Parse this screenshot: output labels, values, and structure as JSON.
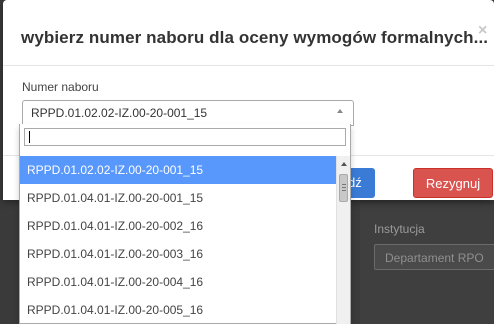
{
  "background": {
    "institution_label": "Instytucja",
    "institution_value": "Departament RPO"
  },
  "modal": {
    "title": "wybierz numer naboru dla oceny wymogów formalnych...",
    "close_symbol": "×",
    "field_label": "Numer naboru",
    "selected_value": "RPPD.01.02.02-IZ.00-20-001_15",
    "search": {
      "value": "",
      "placeholder": ""
    },
    "buttons": {
      "primary_partial_label": "dź",
      "cancel_label": "Rezygnuj"
    },
    "options": [
      "RPPD.01.02.02-IZ.00-20-001_15",
      "RPPD.01.04.01-IZ.00-20-001_15",
      "RPPD.01.04.01-IZ.00-20-002_16",
      "RPPD.01.04.01-IZ.00-20-003_16",
      "RPPD.01.04.01-IZ.00-20-004_16",
      "RPPD.01.04.01-IZ.00-20-005_16"
    ]
  },
  "colors": {
    "active_option": "#5897fb",
    "cancel_button": "#d9534f",
    "primary_button": "#3a7bd5"
  },
  "icons": {
    "close": "close-icon",
    "select_arrow": "chevron-up-icon",
    "scroll_up": "scroll-up-arrow-icon"
  }
}
